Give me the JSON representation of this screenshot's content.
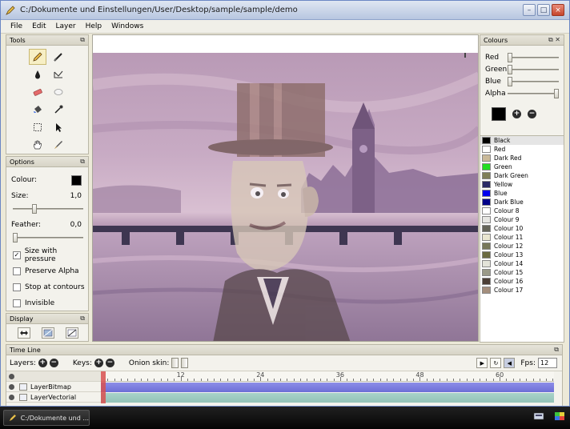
{
  "window": {
    "title": "C:/Dokumente und Einstellungen/User/Desktop/sample/sample/demo"
  },
  "menu": [
    "File",
    "Edit",
    "Layer",
    "Help",
    "Windows"
  ],
  "tools_panel": {
    "title": "Tools",
    "tools": [
      "pencil-icon",
      "pen-icon",
      "ink-drop-icon",
      "polyline-icon",
      "eraser-icon",
      "smudge-icon",
      "bucket-icon",
      "eyedropper-icon",
      "select-icon",
      "arrow-icon",
      "hand-icon",
      "brush-icon"
    ]
  },
  "options_panel": {
    "title": "Options",
    "colour_label": "Colour:",
    "size_label": "Size:",
    "size_value": "1,0",
    "feather_label": "Feather:",
    "feather_value": "0,0",
    "checks": [
      {
        "label": "Size with pressure",
        "checked": true
      },
      {
        "label": "Preserve Alpha",
        "checked": false
      },
      {
        "label": "Stop at contours",
        "checked": false
      },
      {
        "label": "Invisible",
        "checked": false
      }
    ]
  },
  "display_panel": {
    "title": "Display"
  },
  "colours_panel": {
    "title": "Colours",
    "controls": [
      {
        "label": "Red",
        "value": 0
      },
      {
        "label": "Green",
        "value": 0
      },
      {
        "label": "Blue",
        "value": 0
      },
      {
        "label": "Alpha",
        "value": 1
      }
    ],
    "list": [
      {
        "name": "Black",
        "color": "#000000"
      },
      {
        "name": "Red",
        "color": "#ffffff"
      },
      {
        "name": "Dark Red",
        "color": "#c9b999"
      },
      {
        "name": "Green",
        "color": "#22dd22"
      },
      {
        "name": "Dark Green",
        "color": "#7f7f58"
      },
      {
        "name": "Yellow",
        "color": "#2a2a66"
      },
      {
        "name": "Blue",
        "color": "#0000ee"
      },
      {
        "name": "Dark Blue",
        "color": "#000088"
      },
      {
        "name": "Colour 8",
        "color": "#ffffff"
      },
      {
        "name": "Colour 9",
        "color": "#e6e6e2"
      },
      {
        "name": "Colour 10",
        "color": "#66665a"
      },
      {
        "name": "Colour 11",
        "color": "#e9e6d0"
      },
      {
        "name": "Colour 12",
        "color": "#77775a"
      },
      {
        "name": "Colour 13",
        "color": "#6a6a40"
      },
      {
        "name": "Colour 14",
        "color": "#e3e3d9"
      },
      {
        "name": "Colour 15",
        "color": "#9a9a88"
      },
      {
        "name": "Colour 16",
        "color": "#4c3f36"
      },
      {
        "name": "Colour 17",
        "color": "#a48e7c"
      }
    ]
  },
  "timeline": {
    "title": "Time Line",
    "layers_label": "Layers:",
    "keys_label": "Keys:",
    "onion_label": "Onion skin:",
    "fps_label": "Fps:",
    "fps_value": "12",
    "ruler_labels": [
      "12",
      "24",
      "36",
      "48",
      "60"
    ],
    "layers": [
      "LayerBitmap",
      "LayerVectorial"
    ]
  },
  "taskbar": {
    "item_label": "C:/Dokumente und ..."
  }
}
